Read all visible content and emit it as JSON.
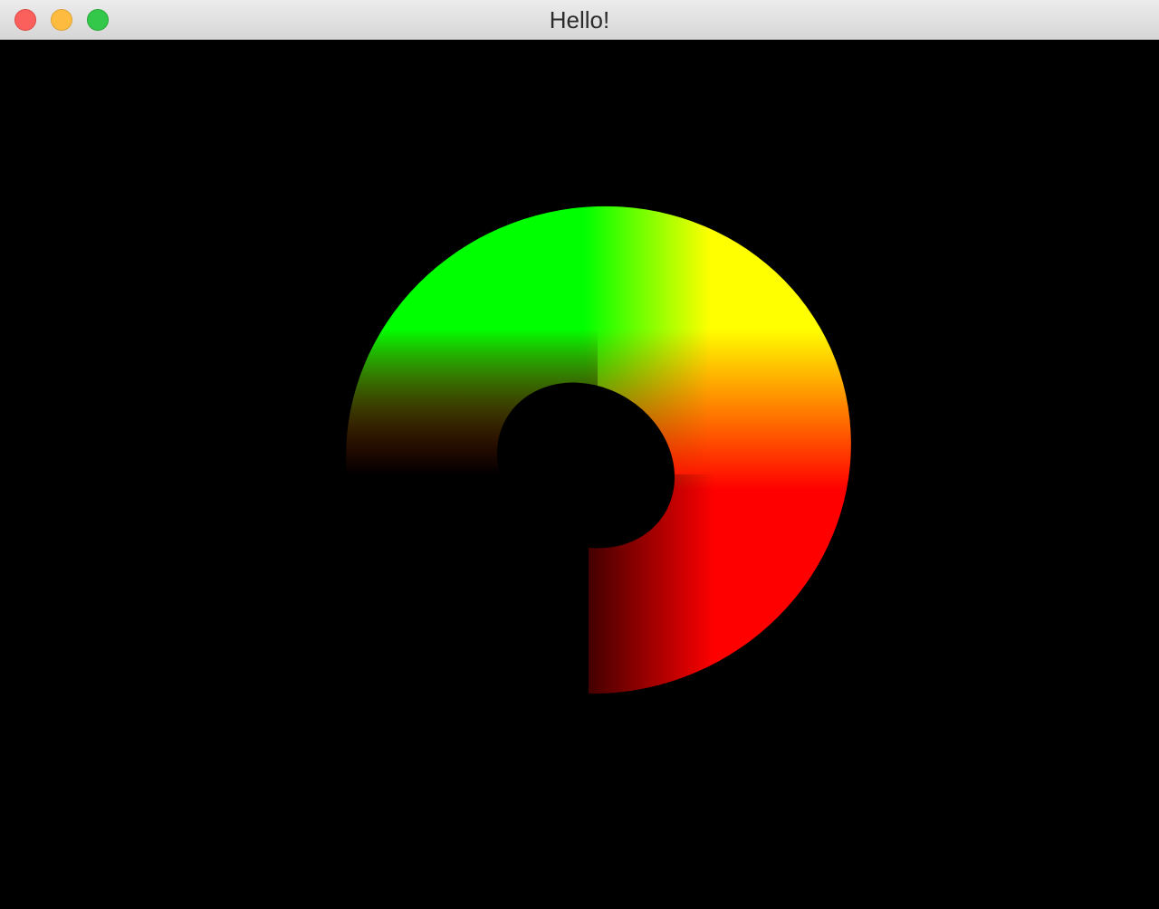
{
  "window": {
    "title": "Hello!",
    "controls": {
      "close": "close-button",
      "minimize": "minimize-button",
      "zoom": "zoom-button"
    }
  },
  "scene": {
    "background": "#000000",
    "object": "torus",
    "colors": {
      "green": "#00ff00",
      "yellow": "#ffff00",
      "red": "#ff0000",
      "shadow": "#000000"
    }
  }
}
